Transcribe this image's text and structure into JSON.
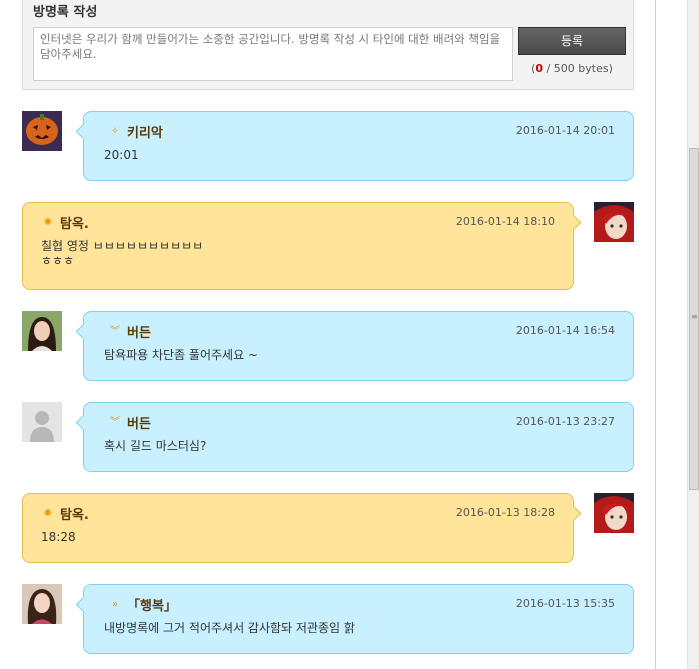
{
  "write": {
    "title": "방명록 작성",
    "placeholder": "인터넷은 우리가 함께 만들어가는 소중한 공간입니다. 방명록 작성 시 타인에 대한 배려와 책임을 담아주세요.",
    "submit_label": "등록",
    "bytes_open": "(",
    "bytes_count": "0",
    "bytes_rest": " / 500 bytes)"
  },
  "entries": [
    {
      "name": "키리악",
      "date": "2016-01-14 20:01",
      "message": "20:01",
      "style": "blue",
      "rank_icon": "rank-wing-icon",
      "avatar": "pumpkin-avatar"
    },
    {
      "name": "탐옥.",
      "date": "2016-01-14 18:10",
      "message": "칠협 영정 ㅂㅂㅂㅂㅂㅂㅂㅂㅂㅂ\nㅎㅎㅎ",
      "style": "yellow",
      "rank_icon": "rank-sun-icon",
      "avatar": "redhair-avatar"
    },
    {
      "name": "버든",
      "date": "2016-01-14 16:54",
      "message": "탐욕파용 차단좀 풀어주세요 ~",
      "style": "blue",
      "rank_icon": "rank-chevron-icon",
      "avatar": "woman-avatar"
    },
    {
      "name": "버든",
      "date": "2016-01-13 23:27",
      "message": "혹시 길드 마스터심?",
      "style": "blue",
      "rank_icon": "rank-chevron-icon",
      "avatar": "default-avatar"
    },
    {
      "name": "탐옥.",
      "date": "2016-01-13 18:28",
      "message": "18:28",
      "style": "yellow",
      "rank_icon": "rank-sun-icon",
      "avatar": "redhair-avatar"
    },
    {
      "name": "「행복」",
      "date": "2016-01-13 15:35",
      "message": "내방명록에 그거 적어주셔서 감사함돠 저관종임 핡",
      "style": "blue",
      "rank_icon": "rank-arrow-icon",
      "avatar": "girl-avatar"
    }
  ],
  "colors": {
    "blue_bubble": "#c8f0ff",
    "yellow_bubble": "#ffe49a",
    "name": "#5a3a0a",
    "bytes_count": "#cc0000"
  }
}
